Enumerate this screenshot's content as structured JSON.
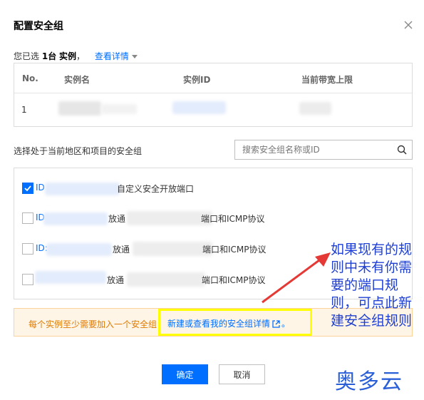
{
  "dialog": {
    "title": "配置安全组"
  },
  "selection": {
    "prefix": "您已选",
    "count": "1台",
    "unit": "实例",
    "separator": "，",
    "details_link": "查看详情"
  },
  "instance_table": {
    "columns": [
      "No.",
      "实例名",
      "实例ID",
      "当前带宽上限"
    ],
    "rows": [
      {
        "no": "1"
      }
    ]
  },
  "security_groups": {
    "label": "选择处于当前地区和项目的安全组",
    "search_placeholder": "搜索安全组名称或ID",
    "items": [
      {
        "id_prefix": "ID",
        "text": "自定义安全开放端口",
        "checked": true
      },
      {
        "id_prefix": "ID",
        "text_a": "放通",
        "text_b": "端口和ICMP协议",
        "checked": false
      },
      {
        "id_prefix": "ID:",
        "text_a": "放通",
        "text_b": "端口和ICMP协议",
        "checked": false
      },
      {
        "id_prefix": "",
        "text_a": "放通",
        "text_b": "端口和ICMP协议",
        "checked": false
      }
    ]
  },
  "notice": {
    "text": "每个实例至少需要加入一个安全组",
    "link": "新建或查看我的安全组详情",
    "end": "。"
  },
  "annotation": {
    "text": "如果现有的规则中未有你需要的端口规则，可点此新建安全组规则"
  },
  "buttons": {
    "ok": "确定",
    "cancel": "取消"
  },
  "watermark": {
    "text": "奥多云"
  },
  "colors": {
    "primary": "#006eff",
    "notice_bg": "#fff5e6",
    "notice_text": "#e07a00",
    "highlight": "#ffff00",
    "annotation": "#1f3fd1",
    "arrow": "#e53935"
  }
}
